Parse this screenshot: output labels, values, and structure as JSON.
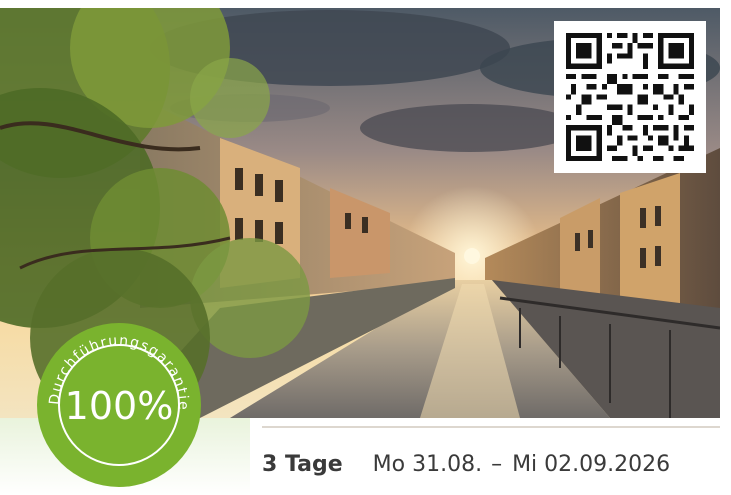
{
  "photo": {
    "subject": "canal"
  },
  "badge": {
    "percent": "100%",
    "arc_text": "Durchführungsgarantie",
    "color": "#7ab32e"
  },
  "trip": {
    "days": "3 Tage",
    "start": "Mo 31.08.",
    "separator": "–",
    "end": "Mi 02.09.2026"
  },
  "qr": {
    "icon": "qr-code-icon"
  }
}
